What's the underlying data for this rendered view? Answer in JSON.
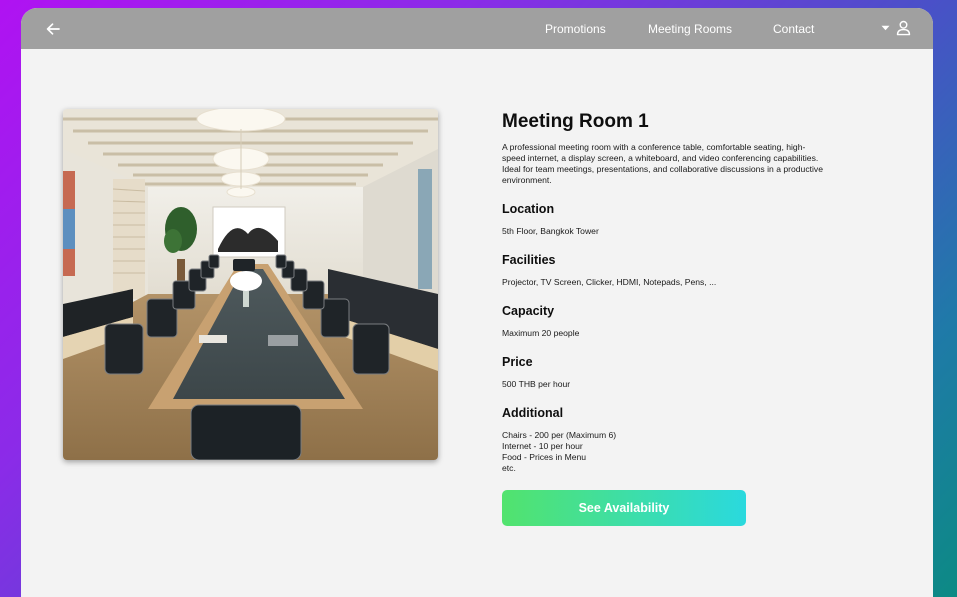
{
  "nav": {
    "back_icon": "arrow-left-icon",
    "links": [
      "Promotions",
      "Meeting Rooms",
      "Contact"
    ],
    "dropdown_icon": "caret-down-icon",
    "user_icon": "user-icon"
  },
  "room": {
    "title": "Meeting Room 1",
    "description": "A professional meeting room with a conference table, comfortable seating, high-speed internet, a display screen, a whiteboard, and video conferencing capabilities. Ideal for team meetings, presentations, and collaborative discussions in a productive environment.",
    "location_label": "Location",
    "location": "5th Floor, Bangkok Tower",
    "facilities_label": "Facilities",
    "facilities": "Projector, TV Screen, Clicker, HDMI, Notepads, Pens, ...",
    "capacity_label": "Capacity",
    "capacity": "Maximum 20 people",
    "price_label": "Price",
    "price": "500 THB per hour",
    "additional_label": "Additional",
    "additional": [
      "Chairs - 200 per (Maximum 6)",
      "Internet - 10 per hour",
      "Food - Prices in Menu",
      "etc."
    ]
  },
  "cta": {
    "label": "See Availability"
  },
  "colors": {
    "navbar": "#a0a0a0",
    "page": "#f3f3f3",
    "cta_start": "#52e36d",
    "cta_end": "#2ad9de"
  }
}
